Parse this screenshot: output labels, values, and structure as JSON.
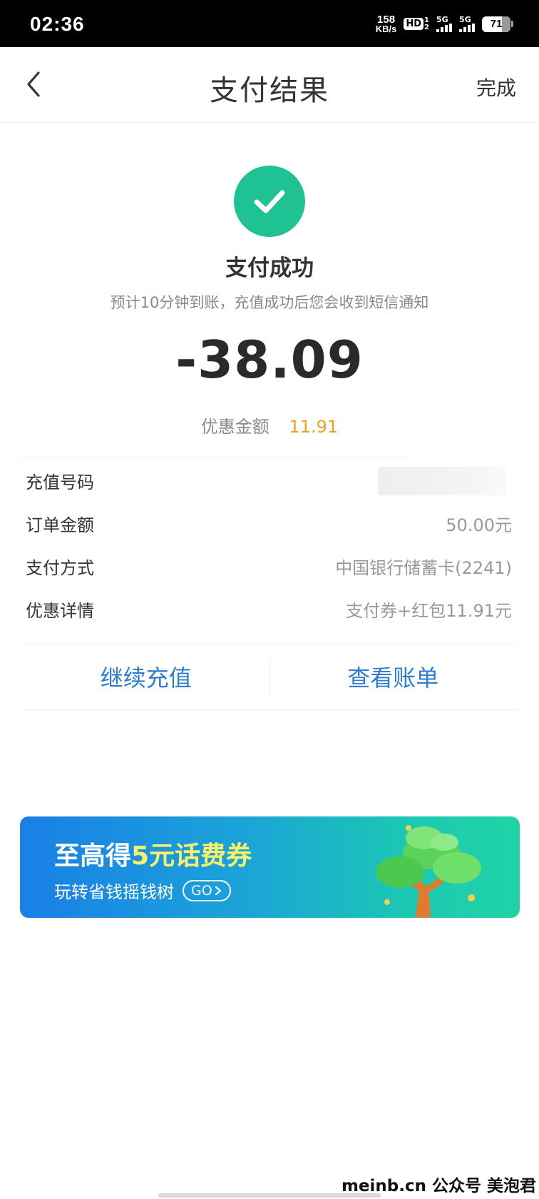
{
  "status_bar": {
    "time": "02:36",
    "net_speed_value": "158",
    "net_speed_unit": "KB/s",
    "hd_label": "HD",
    "hd_sub_top": "1",
    "hd_sub_bottom": "2",
    "sim1_label": "5G",
    "sim2_label": "5G",
    "battery_percent": "71",
    "battery_level": 0.71
  },
  "nav": {
    "back_icon": "chevron-left-icon",
    "title": "支付结果",
    "done_label": "完成"
  },
  "result": {
    "icon": "check-icon",
    "icon_color": "#1fc292",
    "title": "支付成功",
    "note": "预计10分钟到账，充值成功后您会收到短信通知",
    "amount": "-38.09",
    "discount_label": "优惠金额",
    "discount_value": "11.91",
    "discount_color": "#f0a020"
  },
  "details": [
    {
      "label": "充值号码",
      "value": ""
    },
    {
      "label": "订单金额",
      "value": "50.00元"
    },
    {
      "label": "支付方式",
      "value": "中国银行储蓄卡(2241)"
    },
    {
      "label": "优惠详情",
      "value": "支付券+红包11.91元"
    }
  ],
  "actions": {
    "continue_label": "继续充值",
    "bill_label": "查看账单",
    "link_color": "#2d7dd2"
  },
  "banner": {
    "title_prefix": "至高得",
    "title_highlight": "5元话费券",
    "subtitle": "玩转省钱摇钱树",
    "go_label": "GO",
    "illustration": "money-tree-icon"
  },
  "watermark": "meinb.cn  公众号 美泡君"
}
